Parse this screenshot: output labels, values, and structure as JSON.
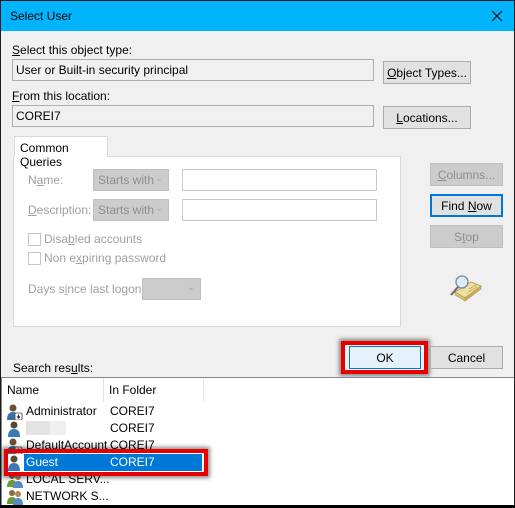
{
  "window": {
    "title": "Select User",
    "close_icon": "close-icon"
  },
  "object_type": {
    "label_prefix": "",
    "label_accel": "S",
    "label_rest": "elect this object type:",
    "value": "User or Built-in security principal",
    "button_accel": "O",
    "button_rest": "bject Types..."
  },
  "location": {
    "label_accel": "F",
    "label_rest": "rom this location:",
    "value": "COREI7",
    "button_accel": "L",
    "button_rest": "ocations..."
  },
  "queries": {
    "tab_label": "Common Queries",
    "name_label_pre": "N",
    "name_label_accel": "a",
    "name_label_post": "me:",
    "name_combo": "Starts with",
    "name_value": "",
    "desc_label_accel": "D",
    "desc_label_rest": "escription:",
    "desc_combo": "Starts with",
    "desc_value": "",
    "disabled_pre": "Disa",
    "disabled_accel": "b",
    "disabled_post": "led accounts",
    "disabled_checked": false,
    "nonexp_pre": "Non e",
    "nonexp_accel": "x",
    "nonexp_post": "piring password",
    "nonexp_checked": false,
    "days_pre": "Days s",
    "days_accel": "i",
    "days_post": "nce last logon:",
    "days_value": ""
  },
  "side_buttons": {
    "columns_accel": "C",
    "columns_rest": "olumns...",
    "find_pre": "Find ",
    "find_accel": "N",
    "find_post": "ow",
    "stop_pre": "S",
    "stop_accel": "t",
    "stop_post": "op"
  },
  "footer": {
    "ok": "OK",
    "cancel": "Cancel",
    "results_pre": "Search res",
    "results_accel": "u",
    "results_post": "lts:"
  },
  "results": {
    "columns": [
      "Name",
      "In Folder"
    ],
    "rows": [
      {
        "name": "Administrator",
        "folder": "COREI7",
        "icon": "admin-user-icon",
        "selected": false
      },
      {
        "name": "",
        "folder": "COREI7",
        "icon": "user-icon",
        "selected": false,
        "redacted": true
      },
      {
        "name": "DefaultAccount",
        "folder": "COREI7",
        "icon": "admin-user-icon",
        "selected": false
      },
      {
        "name": "Guest",
        "folder": "COREI7",
        "icon": "user-icon",
        "selected": true
      },
      {
        "name": "LOCAL SERV...",
        "folder": "",
        "icon": "group-icon",
        "selected": false
      },
      {
        "name": "NETWORK S...",
        "folder": "",
        "icon": "group-icon",
        "selected": false
      }
    ]
  },
  "colors": {
    "titlebar": "#00b4ff",
    "selection": "#0078d7",
    "highlight": "#e60000"
  }
}
